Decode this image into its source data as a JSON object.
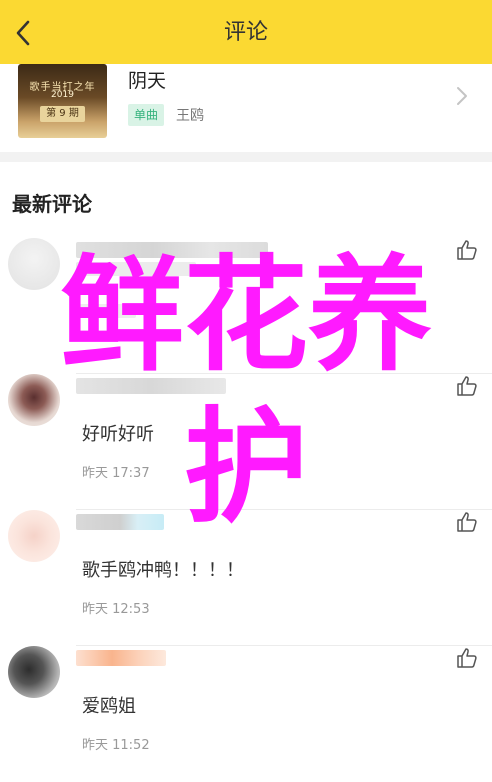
{
  "header": {
    "title": "评论",
    "back_icon": "chevron-left-icon",
    "bg_color": "#fbd932"
  },
  "song": {
    "title": "阴天",
    "tag": "单曲",
    "artist": "王鸥",
    "cover_text": "歌手当打之年",
    "cover_year": "2019",
    "cover_ep": "第 9 期"
  },
  "section": {
    "title": "最新评论"
  },
  "comments": [
    {
      "text": "",
      "time": ""
    },
    {
      "text": "好听好听",
      "time": "昨天 17:37"
    },
    {
      "text": "歌手鸥冲鸭！！！！",
      "time": "昨天 12:53"
    },
    {
      "text": "爱鸥姐",
      "time": "昨天 11:52"
    }
  ],
  "overlay": {
    "line1": "鲜花养",
    "line2": "护",
    "color": "#ff1aff"
  }
}
